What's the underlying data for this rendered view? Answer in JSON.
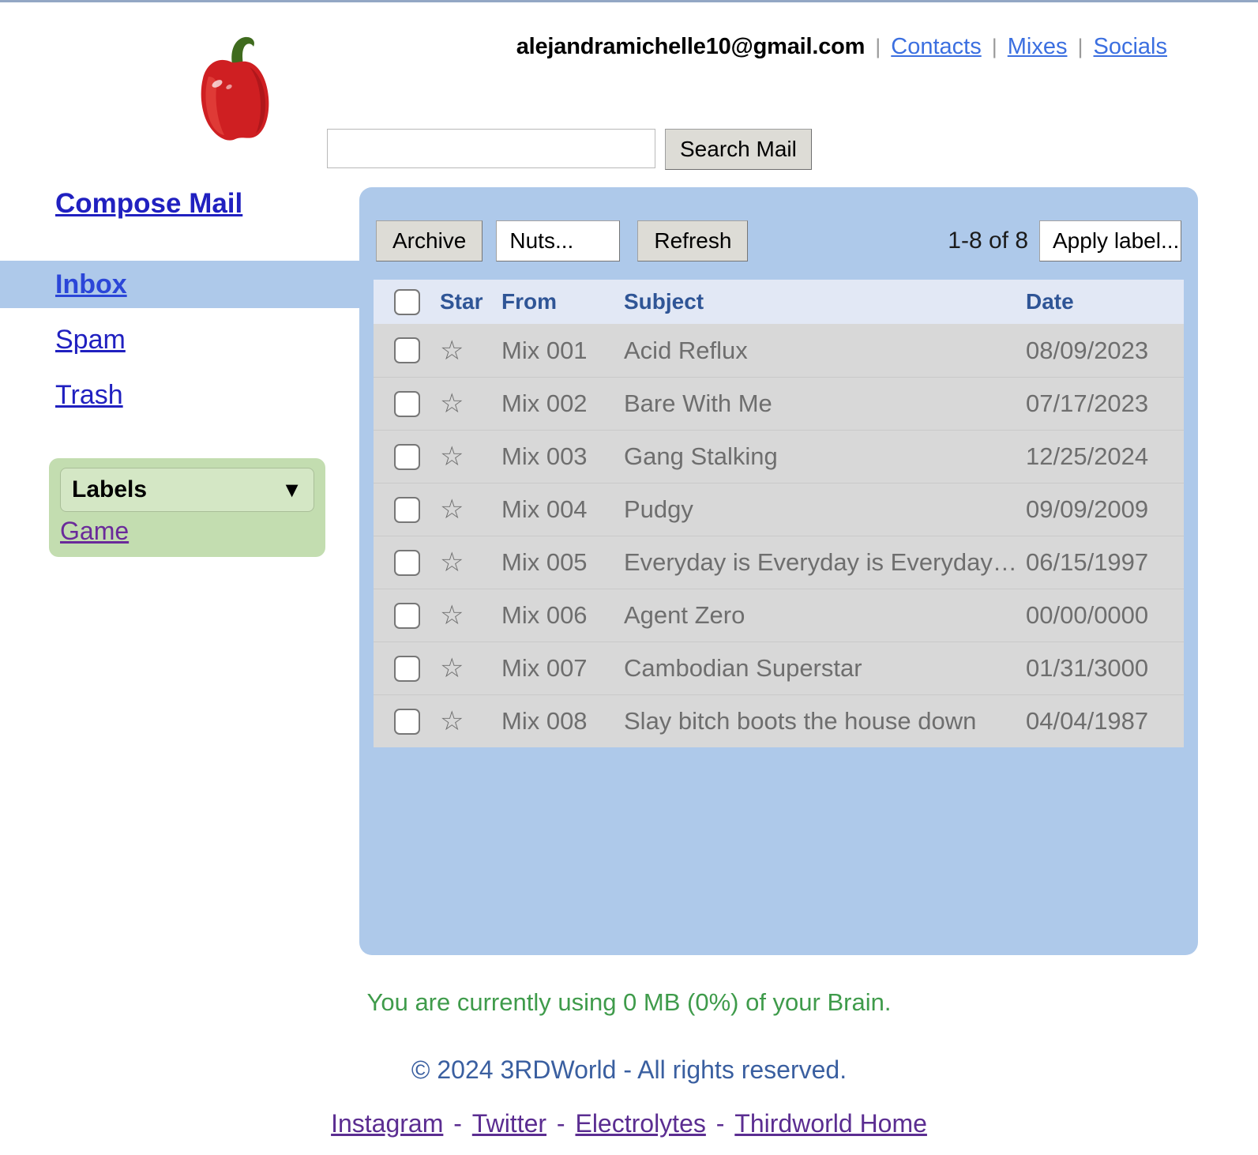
{
  "header": {
    "logo_icon": "red-bell-pepper-logo",
    "account_email": "alejandramichelle10@gmail.com",
    "separator": "|",
    "links": [
      {
        "label": "Contacts"
      },
      {
        "label": "Mixes"
      },
      {
        "label": "Socials"
      }
    ],
    "search": {
      "value": "",
      "placeholder": "",
      "button_label": "Search Mail"
    }
  },
  "sidebar": {
    "compose_label": "Compose Mail",
    "nav": [
      {
        "label": "Inbox",
        "active": true
      },
      {
        "label": "Spam",
        "active": false
      },
      {
        "label": "Trash",
        "active": false
      }
    ],
    "labels_box": {
      "title": "Labels",
      "caret_icon": "chevron-down-icon",
      "caret_glyph": "▼",
      "items": [
        {
          "label": "Game"
        }
      ]
    }
  },
  "toolbar": {
    "archive_label": "Archive",
    "filter_select_value": "Nuts...",
    "refresh_label": "Refresh",
    "count_text": "1-8 of 8",
    "apply_label_value": "Apply label..."
  },
  "mail_table": {
    "columns": [
      "Star",
      "From",
      "Subject",
      "Date"
    ],
    "select_all_checked": false,
    "rows": [
      {
        "checked": false,
        "starred": false,
        "from": "Mix 001",
        "subject": "Acid Reflux",
        "date": "08/09/2023"
      },
      {
        "checked": false,
        "starred": false,
        "from": "Mix 002",
        "subject": "Bare With Me",
        "date": "07/17/2023"
      },
      {
        "checked": false,
        "starred": false,
        "from": "Mix 003",
        "subject": "Gang Stalking",
        "date": "12/25/2024"
      },
      {
        "checked": false,
        "starred": false,
        "from": "Mix 004",
        "subject": "Pudgy",
        "date": "09/09/2009"
      },
      {
        "checked": false,
        "starred": false,
        "from": "Mix 005",
        "subject": "Everyday is Everyday is Everyday is Everyday",
        "date": "06/15/1997"
      },
      {
        "checked": false,
        "starred": false,
        "from": "Mix 006",
        "subject": "Agent Zero",
        "date": "00/00/0000"
      },
      {
        "checked": false,
        "starred": false,
        "from": "Mix 007",
        "subject": "Cambodian Superstar",
        "date": "01/31/3000"
      },
      {
        "checked": false,
        "starred": false,
        "from": "Mix 008",
        "subject": "Slay bitch boots the house down",
        "date": "04/04/1987"
      }
    ],
    "star_glyph": "☆"
  },
  "footer": {
    "storage_note": "You are currently using 0 MB (0%) of your Brain.",
    "copyright": "© 2024 3RDWorld - All rights reserved.",
    "links": [
      {
        "label": "Instagram"
      },
      {
        "label": "Twitter"
      },
      {
        "label": "Electrolytes"
      },
      {
        "label": "Thirdworld Home"
      }
    ],
    "link_separator": "-"
  },
  "colors": {
    "panel_blue": "#aec9ea",
    "row_gray": "#d8d8d8",
    "header_row_blue": "#e2e8f5",
    "link_blue": "#2020c0",
    "label_green": "#c3ddb0",
    "storage_green": "#3f9b4b",
    "copyright_blue": "#3a5fa0",
    "footer_purple": "#5b2d91",
    "column_header_blue": "#2f5596"
  }
}
